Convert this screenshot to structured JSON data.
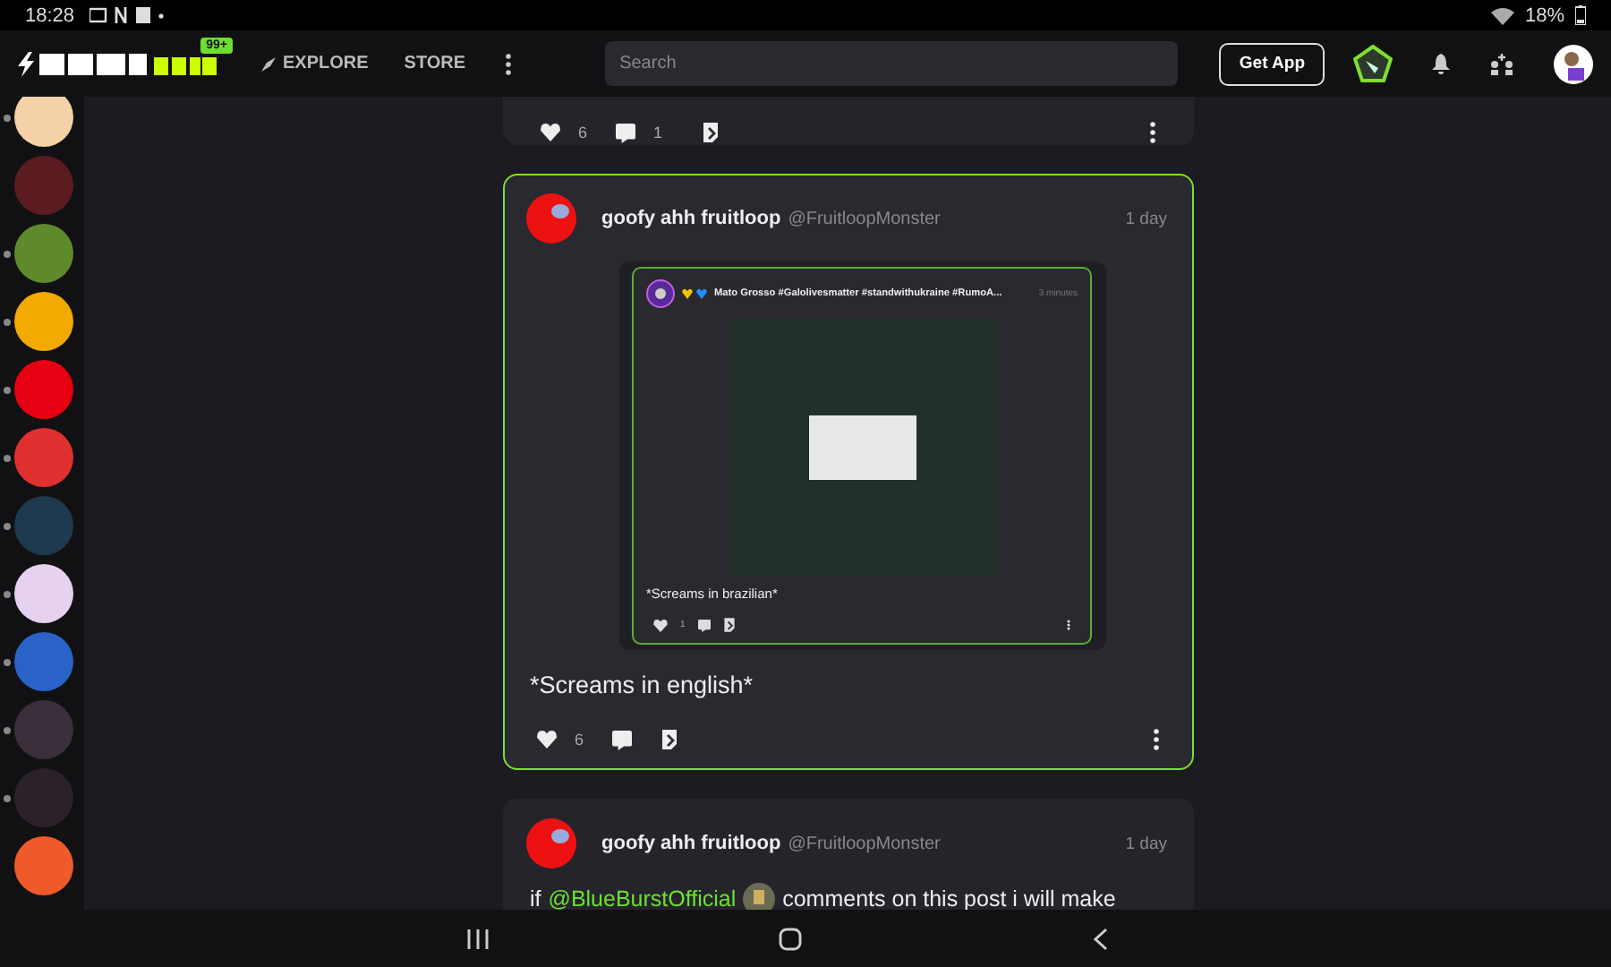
{
  "status_bar": {
    "time": "18:28",
    "battery": "18%"
  },
  "top_nav": {
    "notification_badge": "99+",
    "links": [
      {
        "label": "EXPLORE",
        "kind": "explore"
      },
      {
        "label": "STORE",
        "kind": "plain"
      }
    ],
    "search": {
      "placeholder": "Search"
    },
    "get_app": "Get App"
  },
  "communities": [
    {
      "color": "#f3d3a6",
      "unread": true
    },
    {
      "color": "#5a1c20",
      "unread": false
    },
    {
      "color": "#5f8a2c",
      "unread": true
    },
    {
      "color": "#f2a900",
      "unread": true
    },
    {
      "color": "#e60012",
      "unread": true
    },
    {
      "color": "#e03030",
      "unread": true
    },
    {
      "color": "#1d3a4f",
      "unread": true
    },
    {
      "color": "#e6d2f0",
      "unread": true
    },
    {
      "color": "#2a62c8",
      "unread": true
    },
    {
      "color": "#3b2f3c",
      "unread": true
    },
    {
      "color": "#2a2228",
      "unread": true
    },
    {
      "color": "#ee5a2a",
      "unread": false
    }
  ],
  "posts": [
    {
      "kind": "actions_only",
      "selected": false,
      "likes": "6",
      "comments": "1"
    },
    {
      "kind": "full",
      "selected": true,
      "author": "goofy ahh fruitloop",
      "handle": "@FruitloopMonster",
      "time": "1 day",
      "embed": {
        "title": "Mato Grosso #Galolivesmatter #standwithukraine #RumoA...",
        "time": "3 minutes",
        "text": "*Screams in brazilian*",
        "likes": "1"
      },
      "text": "*Screams in english*",
      "likes": "6"
    },
    {
      "kind": "full",
      "selected": false,
      "author": "goofy ahh fruitloop",
      "handle": "@FruitloopMonster",
      "time": "1 day",
      "text_before": "if",
      "mention": "@BlueBurstOfficial",
      "text_after": "comments on this post i will make"
    }
  ]
}
